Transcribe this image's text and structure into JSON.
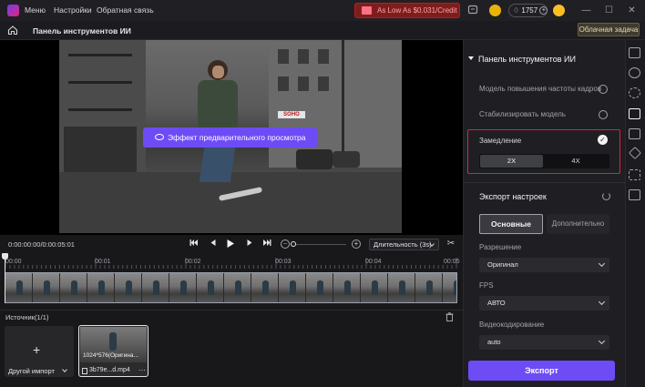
{
  "titlebar": {
    "menu": "Меню",
    "settings": "Настройки",
    "feedback": "Обратная связь",
    "promo": "As Low As $0.031/Credit",
    "credits": "1757",
    "minimize": "—",
    "maximize": "☐",
    "close": "✕"
  },
  "toolbar": {
    "title": "Панель инструментов ИИ",
    "cloud_task": "Облачная задача"
  },
  "preview": {
    "effect_button": "Эффект предварительного просмотра",
    "video_sign": "SOHO"
  },
  "playback": {
    "timecode": "0:00:00:00/0:00:05:01",
    "duration_select": "Длительность (3s)"
  },
  "timeline": {
    "ticks": [
      "00:00",
      "00:01",
      "00:02",
      "00:03",
      "00:04",
      "00:05"
    ]
  },
  "source": {
    "label": "Источник(1/1)",
    "import_plus": "+",
    "import_label": "Другой импорт",
    "clip_resolution": "1024*576(Оригина...",
    "clip_name": "3b79e...d.mp4",
    "clip_more": "···"
  },
  "ai_panel": {
    "header": "Панель инструментов ИИ",
    "options": [
      {
        "label": "Модель повышения частоты кадров"
      },
      {
        "label": "Стабилизировать модель"
      }
    ],
    "slowmo": {
      "label": "Замедление",
      "check": "✓",
      "speeds": [
        "2X",
        "4X"
      ],
      "selected": "2X"
    }
  },
  "export_settings": {
    "title": "Экспорт настроек",
    "tab_basic": "Основные",
    "tab_advanced": "Дополнительно",
    "resolution_label": "Разрешение",
    "resolution_value": "Оригинал",
    "fps_label": "FPS",
    "fps_value": "АВТО",
    "codec_label": "Видеокодирование",
    "codec_value": "auto",
    "export_button": "Экспорт"
  },
  "colors": {
    "accent": "#6d4cf5",
    "highlight_border": "#e11d48",
    "promo_bg": "#7f1d1d"
  },
  "icons": [
    "app-logo-icon",
    "gift-icon",
    "message-icon",
    "coin-icon",
    "diamond-icon",
    "plus-circle-icon",
    "avatar-icon",
    "home-icon",
    "eye-icon",
    "skip-back-icon",
    "step-back-icon",
    "play-icon",
    "step-forward-icon",
    "skip-forward-icon",
    "zoom-out-icon",
    "zoom-in-icon",
    "scissors-icon",
    "trash-icon",
    "reset-icon",
    "check-icon",
    "chevron-down-icon"
  ]
}
